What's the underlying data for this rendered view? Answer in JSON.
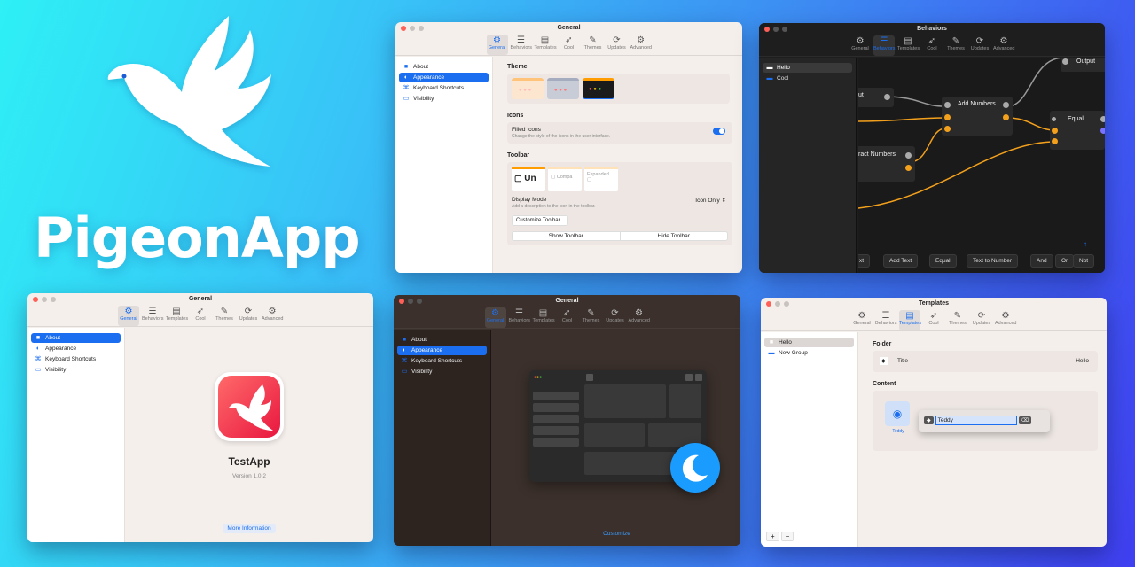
{
  "brand": {
    "name": "PigeonApp"
  },
  "tabs": [
    "General",
    "Behaviors",
    "Templates",
    "Cool",
    "Themes",
    "Updates",
    "Advanced"
  ],
  "sidebar": [
    "About",
    "Appearance",
    "Keyboard Shortcuts",
    "Visibility"
  ],
  "win1": {
    "title": "General",
    "theme_heading": "Theme",
    "icons_heading": "Icons",
    "filled_label": "Filled Icons",
    "filled_sub": "Change the style of the icons in the user interface.",
    "toolbar_heading": "Toolbar",
    "tb_opt1": "Un",
    "tb_opt2": "Compa",
    "tb_opt3": "Expanded",
    "display_mode_label": "Display Mode",
    "display_mode_sub": "Add a description to the icon in the toolbar.",
    "display_mode_value": "Icon Only",
    "customize_btn": "Customize Toolbar...",
    "show_btn": "Show Toolbar",
    "hide_btn": "Hide Toolbar"
  },
  "win2": {
    "title": "Behaviors",
    "list": [
      "Hello",
      "Cool"
    ],
    "nodes": {
      "output": "Output",
      "add_numbers": "Add Numbers",
      "equal": "Equal",
      "input_frag": "ut",
      "subtract_frag": "ract Numbers"
    },
    "buttons": [
      "xt",
      "Add Text",
      "Equal",
      "Text to Number",
      "And",
      "Or",
      "Not"
    ]
  },
  "win3": {
    "title": "General",
    "app_name": "TestApp",
    "version": "Version 1.0.2",
    "more_info": "More Information"
  },
  "win4": {
    "title": "General",
    "customize": "Customize"
  },
  "win5": {
    "title": "Templates",
    "list": [
      "Hello",
      "New Group"
    ],
    "folder_heading": "Folder",
    "title_label": "Title",
    "title_value": "Hello",
    "content_heading": "Content",
    "edit_value": "Teddy",
    "item_label": "Teddy"
  },
  "colors": {
    "accent": "#1b6ef0",
    "node_wire": "#f3a01c",
    "bg_start": "#2ef0f5",
    "bg_end": "#3f3ff0"
  }
}
